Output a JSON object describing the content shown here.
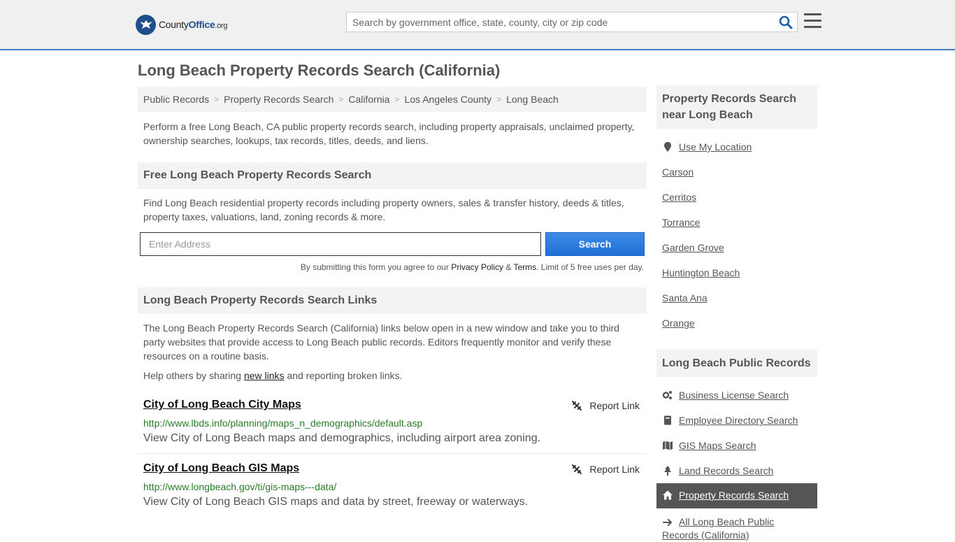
{
  "header": {
    "logo_main": "County",
    "logo_bold": "Office",
    "logo_tld": ".org",
    "search_placeholder": "Search by government office, state, county, city or zip code"
  },
  "page_title": "Long Beach Property Records Search (California)",
  "breadcrumb": [
    "Public Records",
    "Property Records Search",
    "California",
    "Los Angeles County",
    "Long Beach"
  ],
  "intro": "Perform a free Long Beach, CA public property records search, including property appraisals, unclaimed property, ownership searches, lookups, tax records, titles, deeds, and liens.",
  "free_search": {
    "heading": "Free Long Beach Property Records Search",
    "description": "Find Long Beach residential property records including property owners, sales & transfer history, deeds & titles, property taxes, valuations, land, zoning records & more.",
    "address_placeholder": "Enter Address",
    "button_label": "Search",
    "terms_prefix": "By submitting this form you agree to our ",
    "privacy_label": "Privacy Policy",
    "terms_amp": " & ",
    "terms_label": "Terms",
    "terms_suffix": ". Limit of 5 free uses per day."
  },
  "links_section": {
    "heading": "Long Beach Property Records Search Links",
    "description": "The Long Beach Property Records Search (California) links below open in a new window and take you to third party websites that provide access to Long Beach public records. Editors frequently monitor and verify these resources on a routine basis.",
    "help_prefix": "Help others by sharing ",
    "help_link": "new links",
    "help_suffix": " and reporting broken links.",
    "items": [
      {
        "title": "City of Long Beach City Maps",
        "url": "http://www.lbds.info/planning/maps_n_demographics/default.asp",
        "desc": "View City of Long Beach maps and demographics, including airport area zoning.",
        "report": "Report Link"
      },
      {
        "title": "City of Long Beach GIS Maps",
        "url": "http://www.longbeach.gov/ti/gis-maps---data/",
        "desc": "View City of Long Beach GIS maps and data by street, freeway or waterways.",
        "report": "Report Link"
      }
    ]
  },
  "sidebar": {
    "nearby_heading": "Property Records Search near Long Beach",
    "use_location": "Use My Location",
    "nearby": [
      "Carson",
      "Cerritos",
      "Torrance",
      "Garden Grove",
      "Huntington Beach",
      "Santa Ana",
      "Orange"
    ],
    "public_records_heading": "Long Beach Public Records",
    "public_records": [
      {
        "label": "Business License Search",
        "icon": "gears-icon"
      },
      {
        "label": "Employee Directory Search",
        "icon": "book-icon"
      },
      {
        "label": "GIS Maps Search",
        "icon": "map-icon"
      },
      {
        "label": "Land Records Search",
        "icon": "tree-icon"
      },
      {
        "label": "Property Records Search",
        "icon": "home-icon"
      }
    ],
    "all_records_line1": "All Long Beach Public",
    "all_records_line2": "Records (California)"
  },
  "colors": {
    "accent_blue": "#3f80c2",
    "button_blue": "#1f6fd6",
    "url_green": "#2a7a2a",
    "active_bg": "#555555"
  }
}
